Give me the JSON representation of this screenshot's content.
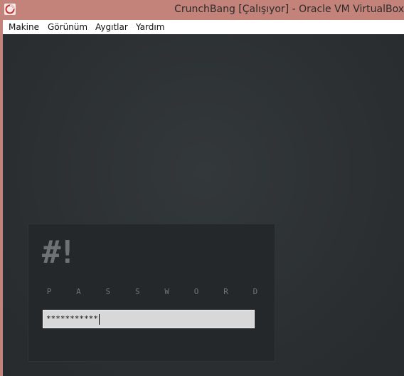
{
  "window": {
    "title": "CrunchBang [Çalışıyor] - Oracle VM VirtualBox",
    "icon": "virtualbox-icon"
  },
  "menubar": {
    "items": [
      {
        "label": "Makine"
      },
      {
        "label": "Görünüm"
      },
      {
        "label": "Aygıtlar"
      },
      {
        "label": "Yardım"
      }
    ]
  },
  "login": {
    "logo": "#!",
    "password_label": "PASSWORD",
    "password_value": "***********"
  },
  "colors": {
    "titlebar": "#c4837a",
    "screen_bg": "#2b3032",
    "panel_bg": "#24282a",
    "input_bg": "#d8d8d8"
  }
}
